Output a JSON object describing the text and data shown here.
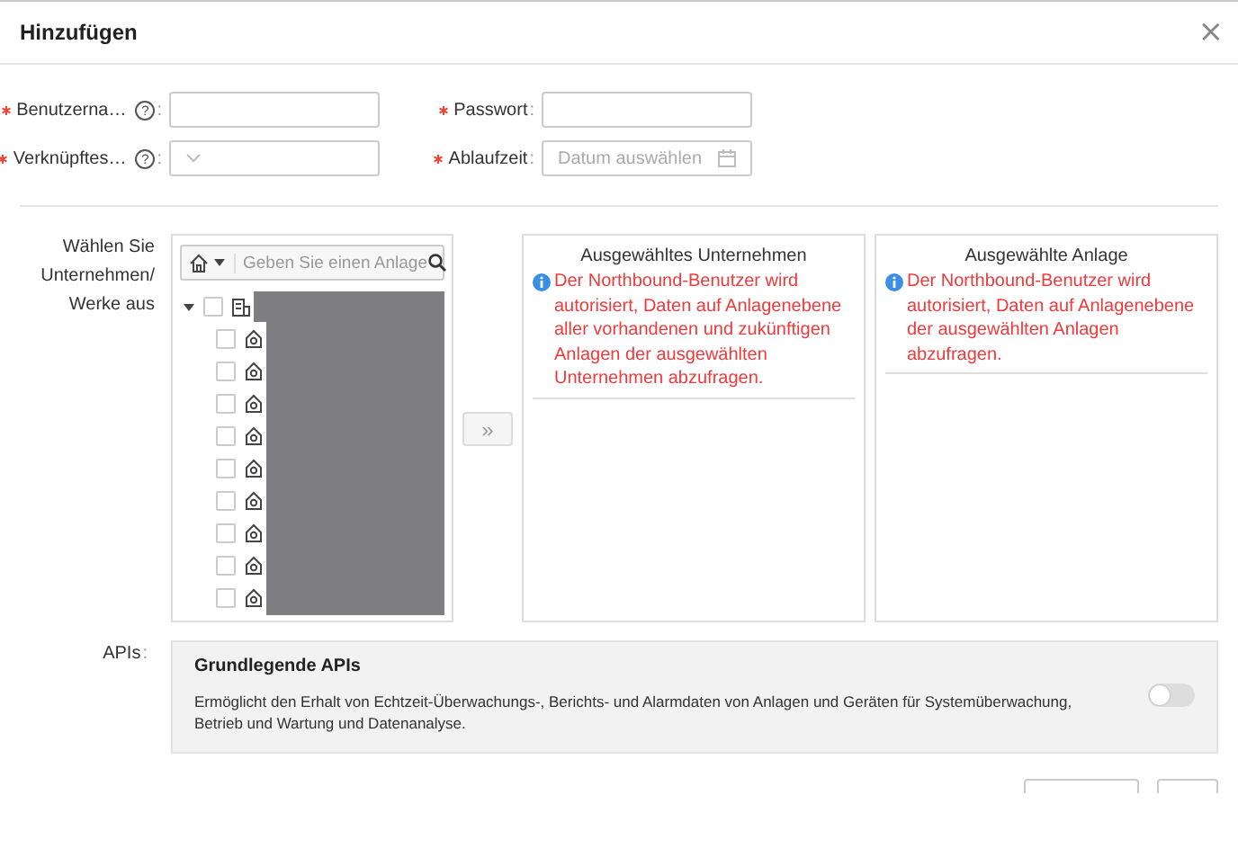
{
  "dialog": {
    "title": "Hinzufügen",
    "close": "×"
  },
  "fields": [
    {
      "kind": "text",
      "label": "Benutzerna…",
      "required": true,
      "help": "?",
      "separator": ":"
    },
    {
      "kind": "password",
      "label": "Passwort",
      "required": true,
      "separator": ":"
    },
    {
      "kind": "select",
      "label": "Verknüpftes…",
      "required": true,
      "help": "?",
      "separator": ":"
    },
    {
      "kind": "date",
      "label": "Ablaufzeit",
      "required": true,
      "separator": ":",
      "placeholder": "Datum auswählen"
    }
  ],
  "selection": {
    "label": "Wählen Sie Unternehmen/ Werke aus",
    "search_placeholder": "Geben Sie einen Anlage",
    "tree": [
      {
        "kind": "company",
        "checked": false,
        "expanded": true,
        "children": [
          {
            "kind": "site",
            "checked": false
          },
          {
            "kind": "site",
            "checked": false
          },
          {
            "kind": "site",
            "checked": false
          },
          {
            "kind": "site",
            "checked": false
          },
          {
            "kind": "site",
            "checked": false
          },
          {
            "kind": "site",
            "checked": false
          },
          {
            "kind": "site",
            "checked": false
          },
          {
            "kind": "site",
            "checked": false
          },
          {
            "kind": "site",
            "checked": false
          }
        ]
      }
    ],
    "move_button": {
      "label": "»",
      "disabled": true
    },
    "panels": [
      {
        "title": "Ausgewähltes Unternehmen",
        "notice": "Der Northbound-Benutzer wird autorisiert, Daten auf Anlagenebene aller vorhandenen und zukünftigen Anlagen der ausgewählten Unternehmen abzufragen."
      },
      {
        "title": "Ausgewählte Anlage",
        "notice": "Der Northbound-Benutzer wird autorisiert, Daten auf Anlagenebene der ausgewählten Anlagen abzufragen."
      }
    ]
  },
  "apis": {
    "label": "APIs",
    "separator": ":",
    "items": [
      {
        "title": "Grundlegende APIs",
        "description": "Ermöglicht den Erhalt von Echtzeit-Überwachungs-, Berichts- und Alarmdaten von Anlagen und Geräten für Systemüberwachung, Betrieb und Wartung und Datenanalyse.",
        "on": false
      }
    ]
  }
}
